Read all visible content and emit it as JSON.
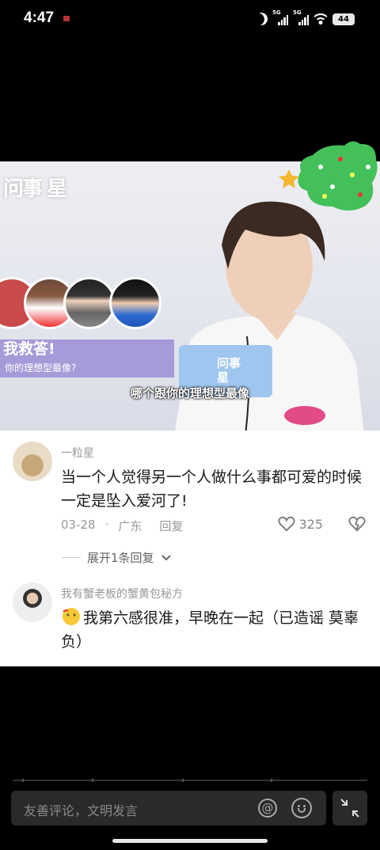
{
  "status_bar": {
    "time": "4:47",
    "network_1": "5G",
    "network_2": "5G",
    "battery": "44"
  },
  "video": {
    "logo_text": "问事 星",
    "banner_title": "我救答!",
    "banner_subtitle": "你的理想型最像?",
    "subtitle": "哪个跟你的理想型最像",
    "mic_card_text": "问事 星"
  },
  "comments": [
    {
      "username": "一粒星",
      "text": "当一个人觉得另一个人做什么事都可爱的时候一定是坠入爱河了!",
      "date": "03-28",
      "location": "广东",
      "reply_label": "回复",
      "likes": "325",
      "expand_label": "展开1条回复"
    },
    {
      "username": "我有蟹老板的蟹黄包秘方",
      "text": "我第六感很准，早晚在一起（已造谣 莫辜负）"
    }
  ],
  "input": {
    "placeholder": "友善评论，文明发言"
  },
  "icons": {
    "at": "at-icon",
    "emoji": "emoji-icon",
    "collapse": "collapse-icon",
    "like": "heart-icon",
    "dislike": "dislike-icon",
    "chevron": "chevron-down-icon"
  }
}
